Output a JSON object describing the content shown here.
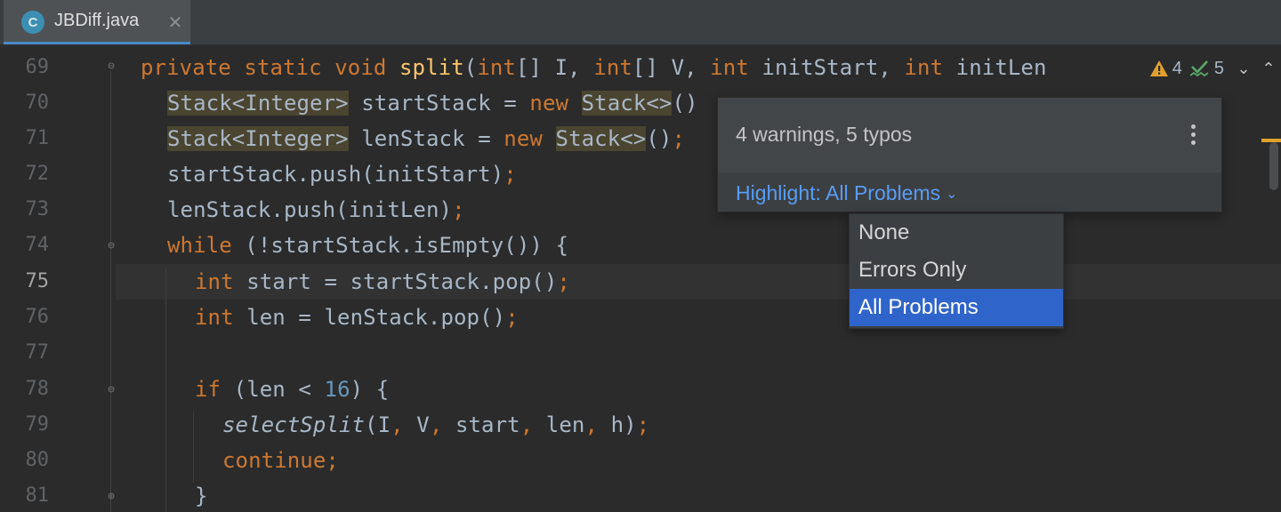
{
  "tab": {
    "icon_letter": "C",
    "title": "JBDiff.java",
    "close_glyph": "✕"
  },
  "inspection": {
    "warnings_count": "4",
    "typos_count": "5",
    "warning_icon": "warning-triangle-icon",
    "typo_icon": "typo-check-icon"
  },
  "popup": {
    "title": "4 warnings, 5 typos",
    "highlight_label": "Highlight: All Problems"
  },
  "highlight_menu": {
    "items": [
      "None",
      "Errors Only",
      "All Problems"
    ],
    "selected": "All Problems"
  },
  "lines": [
    {
      "n": "69"
    },
    {
      "n": "70"
    },
    {
      "n": "71"
    },
    {
      "n": "72"
    },
    {
      "n": "73"
    },
    {
      "n": "74"
    },
    {
      "n": "75"
    },
    {
      "n": "76"
    },
    {
      "n": "77"
    },
    {
      "n": "78"
    },
    {
      "n": "79"
    },
    {
      "n": "80"
    },
    {
      "n": "81"
    }
  ],
  "code": {
    "l69": {
      "k1": "private static void",
      "fn": "split",
      "p1": "(",
      "k2": "int",
      "p2": "[] I, ",
      "k3": "int",
      "p3": "[] V, ",
      "k4": "int",
      "p4": " initStart, ",
      "k5": "int",
      "p5": " initLen"
    },
    "l70": {
      "w1": "Stack<Integer>",
      "p1": " startStack = ",
      "k1": "new",
      "sp": " ",
      "w2": "Stack<>",
      "p2": "()"
    },
    "l71": {
      "w1": "Stack<Integer>",
      "p1": " lenStack = ",
      "k1": "new",
      "sp": " ",
      "w2": "Stack<>",
      "p2": "()",
      "semi": ";"
    },
    "l72": {
      "p1": "startStack.push(initStart)",
      "semi": ";"
    },
    "l73": {
      "p1": "lenStack.push(initLen)",
      "semi": ";"
    },
    "l74": {
      "k1": "while",
      "p1": " (!startStack.isEmpty()) {"
    },
    "l75": {
      "k1": "int",
      "p1": " start = startStack.pop()",
      "semi": ";"
    },
    "l76": {
      "k1": "int",
      "p1": " len = lenStack.pop()",
      "semi": ";"
    },
    "l78": {
      "k1": "if",
      "p1": " (len < ",
      "num": "16",
      "p2": ") {"
    },
    "l79": {
      "it": "selectSplit",
      "p1": "(I",
      "c1": ",",
      "p2": " V",
      "c2": ",",
      "p3": " start",
      "c3": ",",
      "p4": " len",
      "c4": ",",
      "p5": " h)",
      "semi": ";"
    },
    "l80": {
      "k1": "continue",
      "semi": ";"
    },
    "l81": {
      "p1": "}"
    }
  },
  "colors": {
    "keyword": "#cc7832",
    "function": "#ffc66d",
    "number": "#6897bb",
    "text": "#a9b7c6",
    "selection": "#2f65ca",
    "link": "#589df6"
  }
}
